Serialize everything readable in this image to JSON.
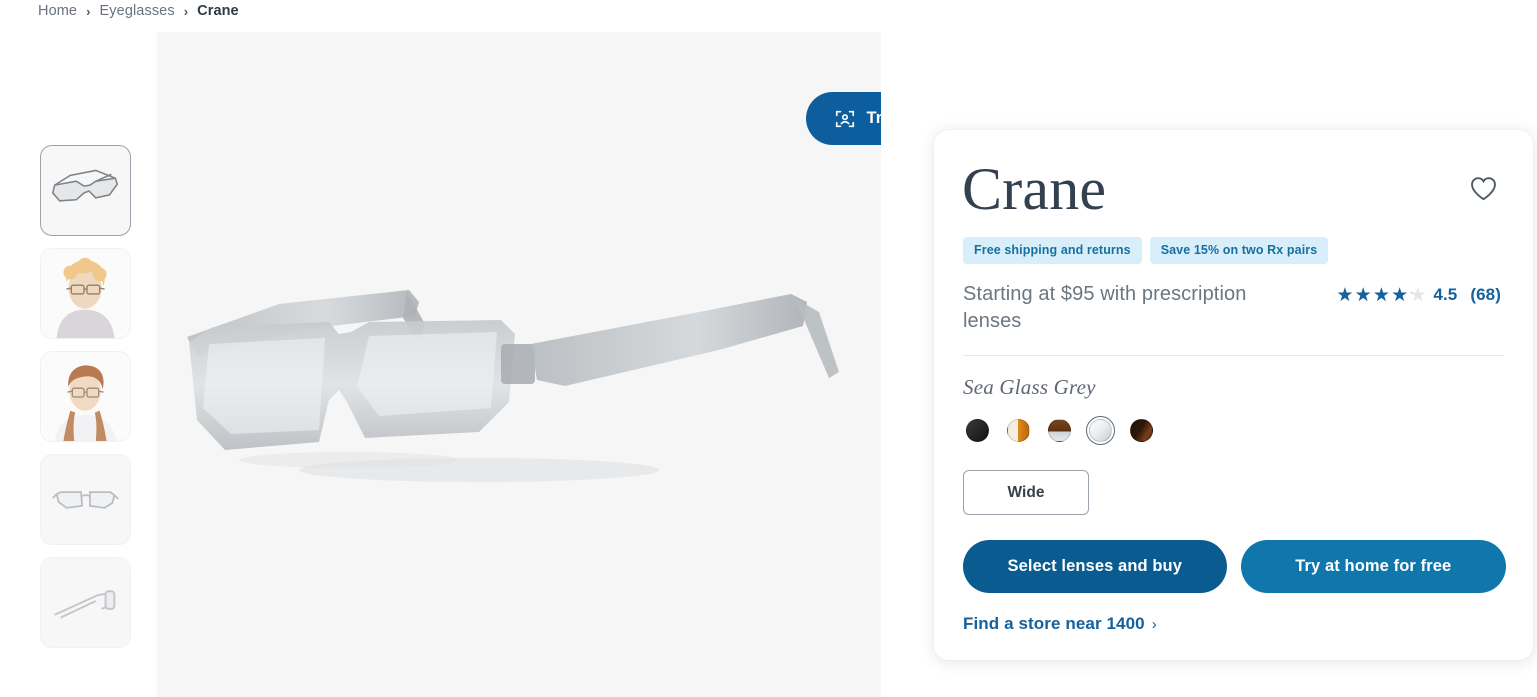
{
  "breadcrumb": {
    "separator": "›",
    "items": [
      {
        "label": "Home",
        "current": false
      },
      {
        "label": "Eyeglasses",
        "current": false
      },
      {
        "label": "Crane",
        "current": true
      }
    ]
  },
  "gallery": {
    "thumbnails": [
      {
        "name": "angled-frame-view",
        "selected": true
      },
      {
        "name": "male-model-wearing",
        "selected": false
      },
      {
        "name": "female-model-wearing",
        "selected": false
      },
      {
        "name": "front-frame-view",
        "selected": false
      },
      {
        "name": "side-temple-view",
        "selected": false
      }
    ],
    "main_image_alt": "Crane eyeglasses in Sea Glass Grey, angled view",
    "try_on": {
      "label": "Try on virtually",
      "icon": "face-scan-icon",
      "color": "#0a5fa0"
    }
  },
  "product": {
    "title": "Crane",
    "favorite_icon": "heart-icon",
    "badges": [
      "Free shipping and returns",
      "Save 15% on two Rx pairs"
    ],
    "badge_bg": "#d8eefa",
    "badge_color": "#15719f",
    "price_text": "Starting at $95 with prescription lenses",
    "rating": {
      "value": 4.5,
      "display": "4.5",
      "count_display": "(68)",
      "stars_filled_percent": 90,
      "star_color": "#15619b"
    },
    "color": {
      "name": "Sea Glass Grey",
      "swatches": [
        {
          "name": "jet-black",
          "hex": "#1c1c1c",
          "selected": false
        },
        {
          "name": "cream-tortoise",
          "hex": "#f2ead8",
          "accent": "#e08b18",
          "selected": false
        },
        {
          "name": "walnut-tortoise",
          "hex": "#6d3b1c",
          "accent": "#cfd5d8",
          "selected": false
        },
        {
          "name": "sea-glass-grey",
          "hex": "#e4e6e7",
          "accent": "#c9cdcf",
          "selected": true
        },
        {
          "name": "espresso-tortoise",
          "hex": "#3a1f10",
          "accent": "#7a3f18",
          "selected": false
        }
      ]
    },
    "size": {
      "label": "Wide",
      "selected": true
    },
    "actions": {
      "primary": {
        "label": "Select lenses and buy",
        "color": "#0a5c90"
      },
      "secondary": {
        "label": "Try at home for free",
        "color": "#0f77ab"
      }
    },
    "store_link": {
      "label": "Find a store near 1400",
      "chevron": "›"
    }
  }
}
